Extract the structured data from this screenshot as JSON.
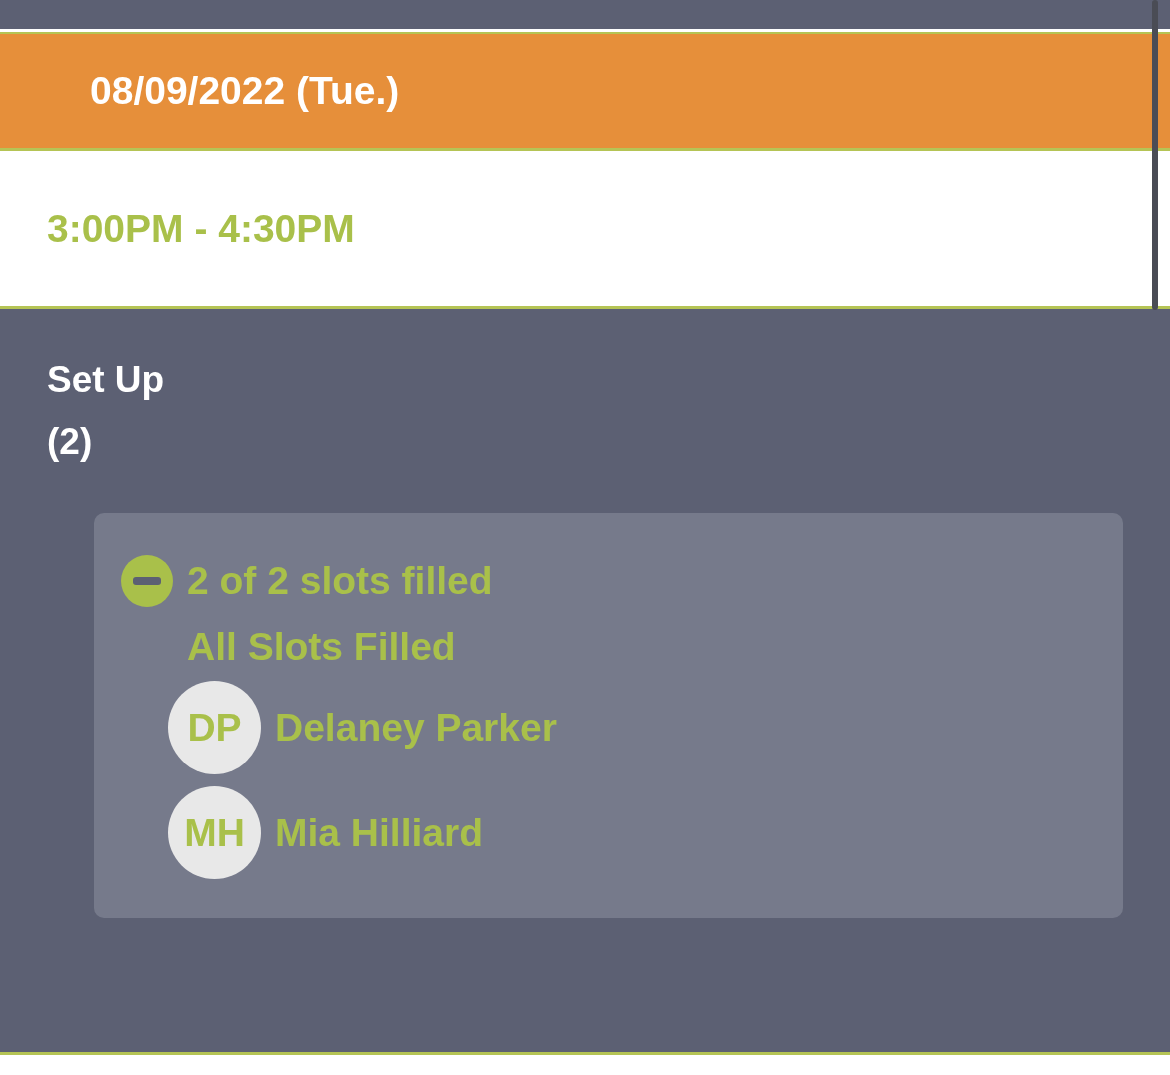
{
  "date_header": "08/09/2022 (Tue.)",
  "time_slot": "3:00PM - 4:30PM",
  "role": {
    "title": "Set Up",
    "count": "(2)"
  },
  "signup": {
    "expanded": true,
    "summary": "2 of 2 slots filled",
    "status": "All Slots Filled",
    "people": [
      {
        "initials": "DP",
        "name": "Delaney Parker"
      },
      {
        "initials": "MH",
        "name": "Mia Hilliard"
      }
    ]
  }
}
